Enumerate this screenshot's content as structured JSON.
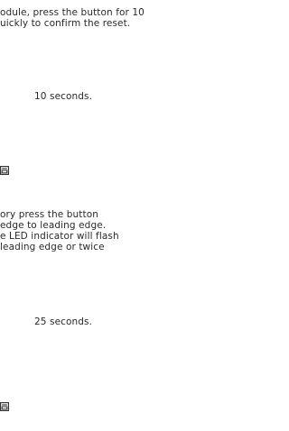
{
  "section1": {
    "lines": [
      "odule, press the button for 10",
      "uickly to confirm the reset."
    ],
    "duration": "10 seconds."
  },
  "section2": {
    "lines": [
      "ory press the button",
      " edge to leading edge.",
      "e LED indicator will flash",
      " leading edge or twice"
    ],
    "duration": "25 seconds."
  },
  "icons": [
    "fax-icon",
    "fax-icon"
  ]
}
